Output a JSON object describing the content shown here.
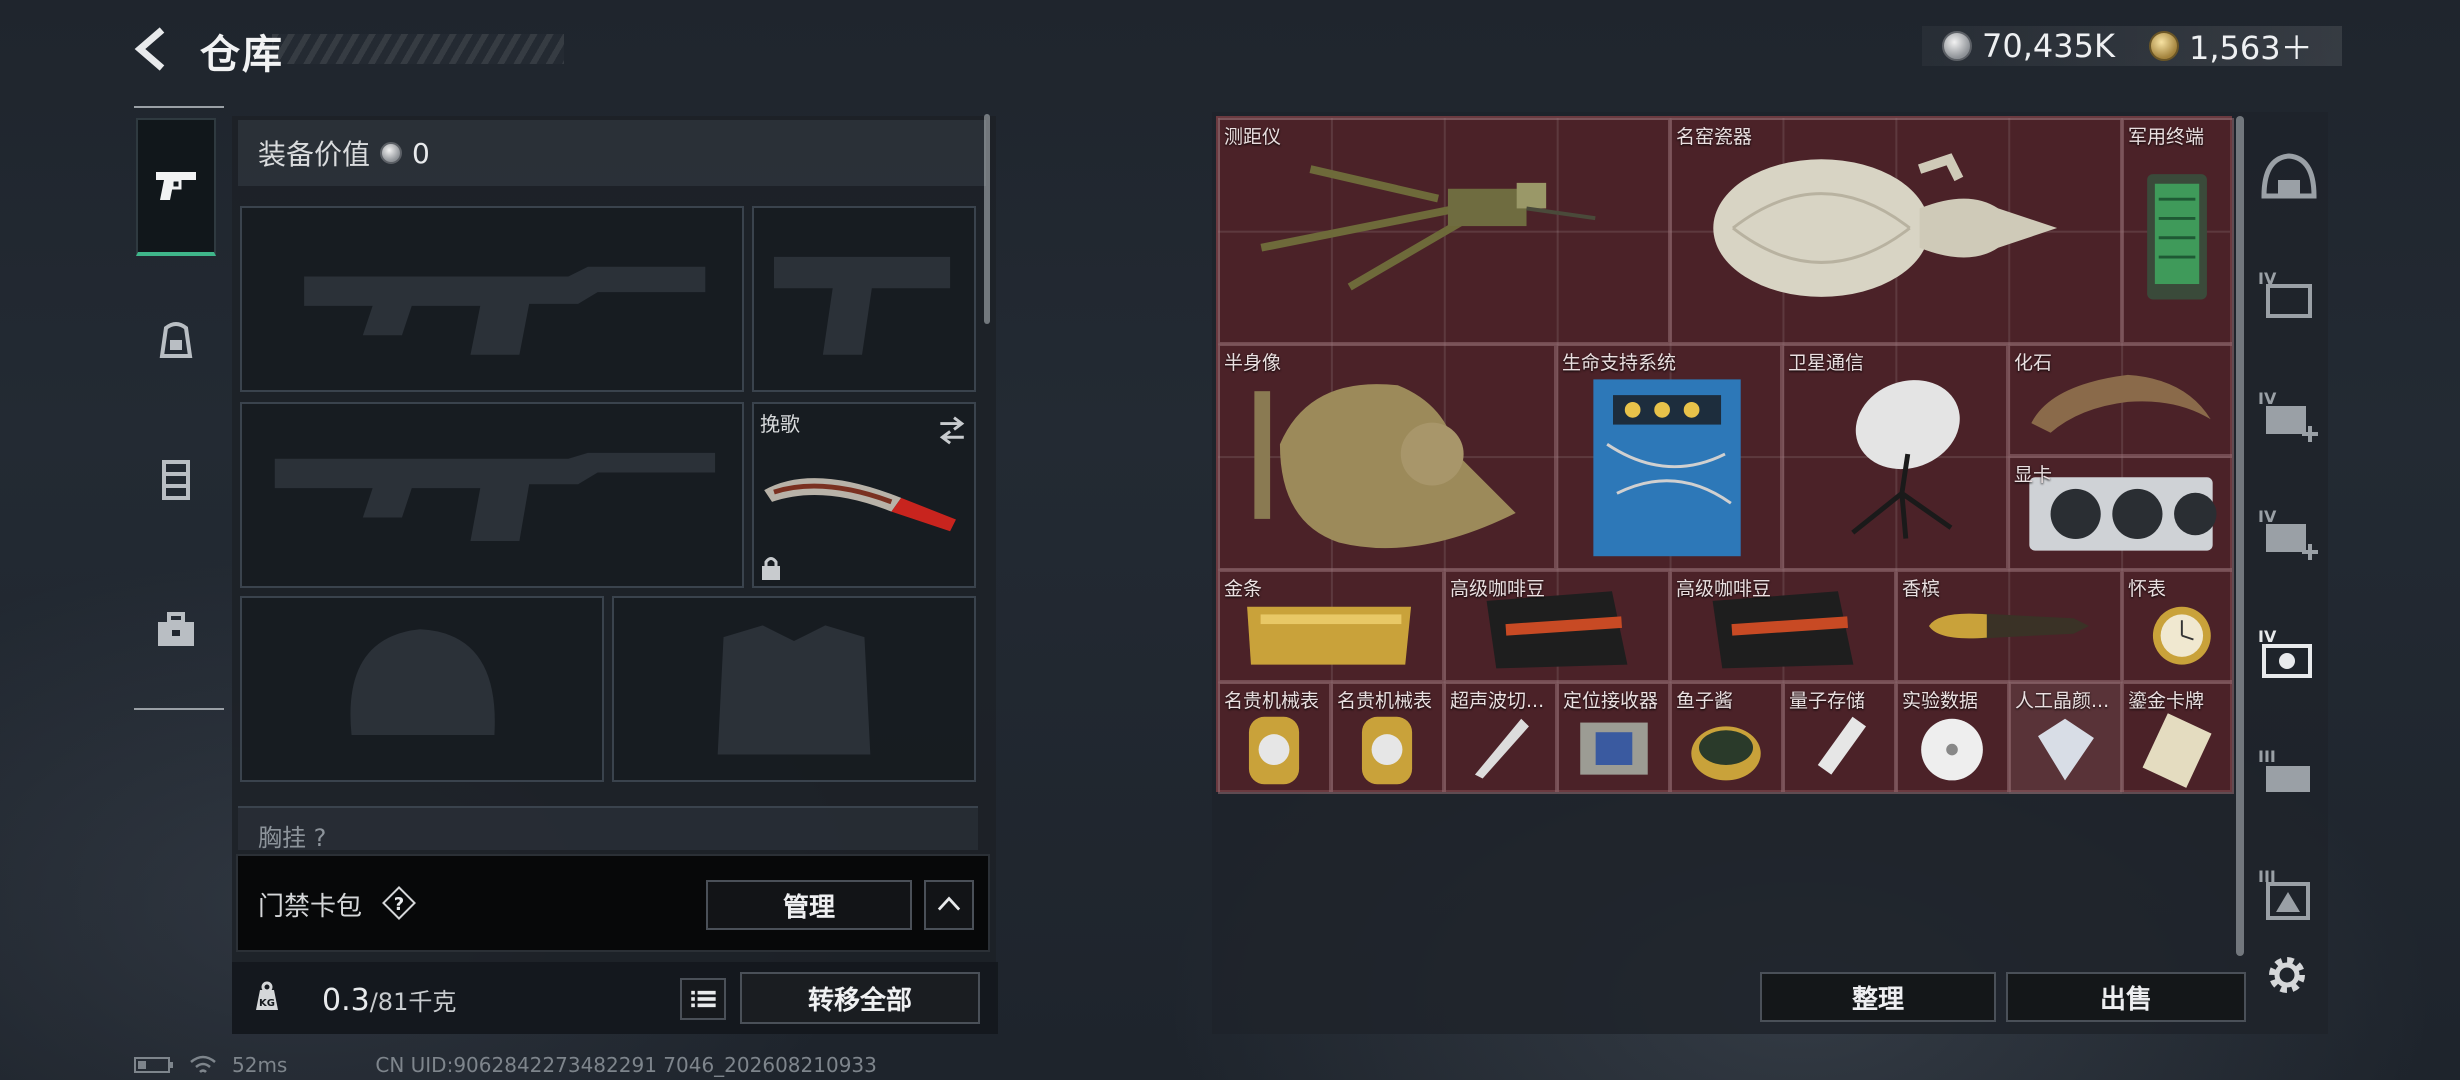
{
  "header": {
    "title": "仓库",
    "currencies": [
      {
        "name": "coin-silver",
        "value": "70,435K"
      },
      {
        "name": "coin-gold",
        "value": "1,563＋"
      }
    ]
  },
  "left_rail": {
    "tabs": [
      "pistol-icon",
      "backpack-icon",
      "vest-icon",
      "toolbox-icon"
    ]
  },
  "equipment": {
    "label": "装备价值",
    "value": "0",
    "slots": {
      "knife_label": "挽歌"
    },
    "chest_label": "胸挂 ?"
  },
  "keycard": {
    "label": "门禁卡包",
    "help": "?",
    "manage_label": "管理"
  },
  "weight": {
    "current": "0.3",
    "max": "/81千克"
  },
  "actions": {
    "transfer_all": "转移全部",
    "sort": "整理",
    "sell": "出售"
  },
  "storage": {
    "items": [
      {
        "label": "测距仪",
        "icon": "tripod-rangefinder"
      },
      {
        "label": "名窑瓷器",
        "icon": "porcelain-vase"
      },
      {
        "label": "军用终端",
        "icon": "military-terminal"
      },
      {
        "label": "半身像",
        "icon": "bust-statue"
      },
      {
        "label": "生命支持系统",
        "icon": "life-support"
      },
      {
        "label": "卫星通信",
        "icon": "satellite-dish"
      },
      {
        "label": "化石",
        "icon": "fossil-claw"
      },
      {
        "label": "显卡",
        "icon": "graphics-card"
      },
      {
        "label": "金条",
        "icon": "gold-bar"
      },
      {
        "label": "高级咖啡豆",
        "icon": "coffee-bag"
      },
      {
        "label": "高级咖啡豆",
        "icon": "coffee-bag"
      },
      {
        "label": "香槟",
        "icon": "champagne"
      },
      {
        "label": "怀表",
        "icon": "pocket-watch"
      },
      {
        "label": "名贵机械表",
        "icon": "gold-watch"
      },
      {
        "label": "名贵机械表",
        "icon": "gold-watch"
      },
      {
        "label": "超声波切...",
        "icon": "ultrasonic-cutter"
      },
      {
        "label": "定位接收器",
        "icon": "gps-receiver"
      },
      {
        "label": "鱼子酱",
        "icon": "caviar-tin"
      },
      {
        "label": "量子存储",
        "icon": "usb-drive"
      },
      {
        "label": "实验数据",
        "icon": "data-disc"
      },
      {
        "label": "人工晶颜...",
        "icon": "crystal"
      },
      {
        "label": "鎏金卡牌",
        "icon": "gilded-card"
      }
    ]
  },
  "right_rail": [
    "helmet-icon",
    "crate-iv-icon",
    "medkit-iv-icon",
    "medkit-iv-2-icon",
    "camera-iv-icon",
    "crate-iii-icon",
    "box-iii-icon",
    "gear-icon"
  ],
  "footer": {
    "ping": "52ms",
    "uid": "CN UID:9062842273482291 7046_202608210933"
  },
  "colors": {
    "storage_bg": "#4b2228",
    "accent_green": "#3fb68a"
  }
}
